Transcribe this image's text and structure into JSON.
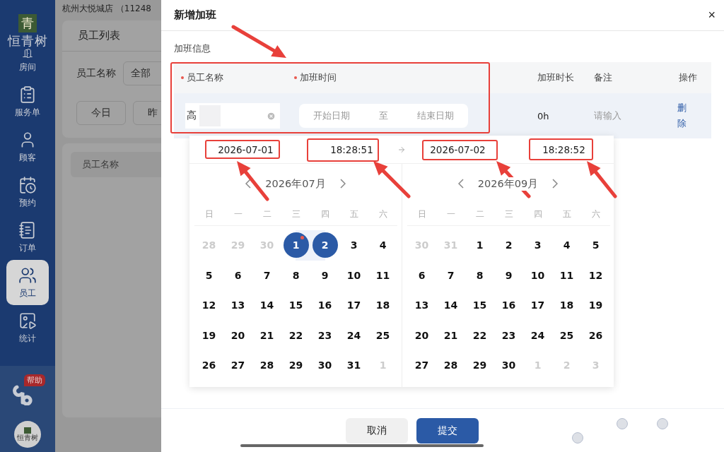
{
  "sidebar": {
    "logo_mark": "青",
    "logo_text": "恒青树",
    "items": [
      {
        "label": "房间",
        "selected": false
      },
      {
        "label": "服务单",
        "selected": false
      },
      {
        "label": "顾客",
        "selected": false
      },
      {
        "label": "预约",
        "selected": false
      },
      {
        "label": "订单",
        "selected": false
      },
      {
        "label": "员工",
        "selected": true
      },
      {
        "label": "统计",
        "selected": false
      }
    ],
    "help_badge": "帮助",
    "avatar_text": "恒青树"
  },
  "background": {
    "store": "杭州大悦城店  （11248",
    "tabs": [
      {
        "label": "员工列表",
        "selected": true
      }
    ],
    "filter_label": "员工名称",
    "filter_value": "全部",
    "quick_dates": [
      "今日",
      "昨"
    ],
    "table_header": "员工名称"
  },
  "dialog": {
    "title": "新增加班",
    "close": "×",
    "section": "加班信息",
    "columns": [
      {
        "label": "员工名称",
        "required": true
      },
      {
        "label": "加班时间",
        "required": true
      },
      {
        "label": "加班时长",
        "required": false
      },
      {
        "label": "备注",
        "required": false
      },
      {
        "label": "操作",
        "required": false
      }
    ],
    "row": {
      "name": "高",
      "time_start_placeholder": "开始日期",
      "time_sep": "至",
      "time_end_placeholder": "结束日期",
      "duration": "0h",
      "remark_placeholder": "请输入",
      "action": "删除"
    },
    "picker": {
      "start_date": "2026-07-01",
      "start_time": "18:28:51",
      "end_date": "2026-07-02",
      "end_time": "18:28:52",
      "panels": [
        {
          "month": "2026年07月",
          "weekdays": [
            "日",
            "一",
            "二",
            "三",
            "四",
            "五",
            "六"
          ],
          "days": [
            {
              "label": "28",
              "muted": true,
              "selected": false,
              "today": false
            },
            {
              "label": "29",
              "muted": true,
              "selected": false,
              "today": false
            },
            {
              "label": "30",
              "muted": true,
              "selected": false,
              "today": false
            },
            {
              "label": "1",
              "muted": false,
              "selected": true,
              "today": true
            },
            {
              "label": "2",
              "muted": false,
              "selected": true,
              "today": false
            },
            {
              "label": "3",
              "muted": false,
              "selected": false,
              "today": false
            },
            {
              "label": "4",
              "muted": false,
              "selected": false,
              "today": false
            },
            {
              "label": "5",
              "muted": false,
              "selected": false,
              "today": false
            },
            {
              "label": "6",
              "muted": false,
              "selected": false,
              "today": false
            },
            {
              "label": "7",
              "muted": false,
              "selected": false,
              "today": false
            },
            {
              "label": "8",
              "muted": false,
              "selected": false,
              "today": false
            },
            {
              "label": "9",
              "muted": false,
              "selected": false,
              "today": false
            },
            {
              "label": "10",
              "muted": false,
              "selected": false,
              "today": false
            },
            {
              "label": "11",
              "muted": false,
              "selected": false,
              "today": false
            },
            {
              "label": "12",
              "muted": false,
              "selected": false,
              "today": false
            },
            {
              "label": "13",
              "muted": false,
              "selected": false,
              "today": false
            },
            {
              "label": "14",
              "muted": false,
              "selected": false,
              "today": false
            },
            {
              "label": "15",
              "muted": false,
              "selected": false,
              "today": false
            },
            {
              "label": "16",
              "muted": false,
              "selected": false,
              "today": false
            },
            {
              "label": "17",
              "muted": false,
              "selected": false,
              "today": false
            },
            {
              "label": "18",
              "muted": false,
              "selected": false,
              "today": false
            },
            {
              "label": "19",
              "muted": false,
              "selected": false,
              "today": false
            },
            {
              "label": "20",
              "muted": false,
              "selected": false,
              "today": false
            },
            {
              "label": "21",
              "muted": false,
              "selected": false,
              "today": false
            },
            {
              "label": "22",
              "muted": false,
              "selected": false,
              "today": false
            },
            {
              "label": "23",
              "muted": false,
              "selected": false,
              "today": false
            },
            {
              "label": "24",
              "muted": false,
              "selected": false,
              "today": false
            },
            {
              "label": "25",
              "muted": false,
              "selected": false,
              "today": false
            },
            {
              "label": "26",
              "muted": false,
              "selected": false,
              "today": false
            },
            {
              "label": "27",
              "muted": false,
              "selected": false,
              "today": false
            },
            {
              "label": "28",
              "muted": false,
              "selected": false,
              "today": false
            },
            {
              "label": "29",
              "muted": false,
              "selected": false,
              "today": false
            },
            {
              "label": "30",
              "muted": false,
              "selected": false,
              "today": false
            },
            {
              "label": "31",
              "muted": false,
              "selected": false,
              "today": false
            },
            {
              "label": "1",
              "muted": true,
              "selected": false,
              "today": false
            }
          ]
        },
        {
          "month": "2026年09月",
          "weekdays": [
            "日",
            "一",
            "二",
            "三",
            "四",
            "五",
            "六"
          ],
          "days": [
            {
              "label": "30",
              "muted": true,
              "selected": false,
              "today": false
            },
            {
              "label": "31",
              "muted": true,
              "selected": false,
              "today": false
            },
            {
              "label": "1",
              "muted": false,
              "selected": false,
              "today": false
            },
            {
              "label": "2",
              "muted": false,
              "selected": false,
              "today": false
            },
            {
              "label": "3",
              "muted": false,
              "selected": false,
              "today": false
            },
            {
              "label": "4",
              "muted": false,
              "selected": false,
              "today": false
            },
            {
              "label": "5",
              "muted": false,
              "selected": false,
              "today": false
            },
            {
              "label": "6",
              "muted": false,
              "selected": false,
              "today": false
            },
            {
              "label": "7",
              "muted": false,
              "selected": false,
              "today": false
            },
            {
              "label": "8",
              "muted": false,
              "selected": false,
              "today": false
            },
            {
              "label": "9",
              "muted": false,
              "selected": false,
              "today": false
            },
            {
              "label": "10",
              "muted": false,
              "selected": false,
              "today": false
            },
            {
              "label": "11",
              "muted": false,
              "selected": false,
              "today": false
            },
            {
              "label": "12",
              "muted": false,
              "selected": false,
              "today": false
            },
            {
              "label": "13",
              "muted": false,
              "selected": false,
              "today": false
            },
            {
              "label": "14",
              "muted": false,
              "selected": false,
              "today": false
            },
            {
              "label": "15",
              "muted": false,
              "selected": false,
              "today": false
            },
            {
              "label": "16",
              "muted": false,
              "selected": false,
              "today": false
            },
            {
              "label": "17",
              "muted": false,
              "selected": false,
              "today": false
            },
            {
              "label": "18",
              "muted": false,
              "selected": false,
              "today": false
            },
            {
              "label": "19",
              "muted": false,
              "selected": false,
              "today": false
            },
            {
              "label": "20",
              "muted": false,
              "selected": false,
              "today": false
            },
            {
              "label": "21",
              "muted": false,
              "selected": false,
              "today": false
            },
            {
              "label": "22",
              "muted": false,
              "selected": false,
              "today": false
            },
            {
              "label": "23",
              "muted": false,
              "selected": false,
              "today": false
            },
            {
              "label": "24",
              "muted": false,
              "selected": false,
              "today": false
            },
            {
              "label": "25",
              "muted": false,
              "selected": false,
              "today": false
            },
            {
              "label": "26",
              "muted": false,
              "selected": false,
              "today": false
            },
            {
              "label": "27",
              "muted": false,
              "selected": false,
              "today": false
            },
            {
              "label": "28",
              "muted": false,
              "selected": false,
              "today": false
            },
            {
              "label": "29",
              "muted": false,
              "selected": false,
              "today": false
            },
            {
              "label": "30",
              "muted": false,
              "selected": false,
              "today": false
            },
            {
              "label": "1",
              "muted": true,
              "selected": false,
              "today": false
            },
            {
              "label": "2",
              "muted": true,
              "selected": false,
              "today": false
            },
            {
              "label": "3",
              "muted": true,
              "selected": false,
              "today": false
            }
          ]
        }
      ]
    },
    "buttons": [
      {
        "label": "取消",
        "kind": "secondary"
      },
      {
        "label": "提交",
        "kind": "primary"
      }
    ]
  }
}
